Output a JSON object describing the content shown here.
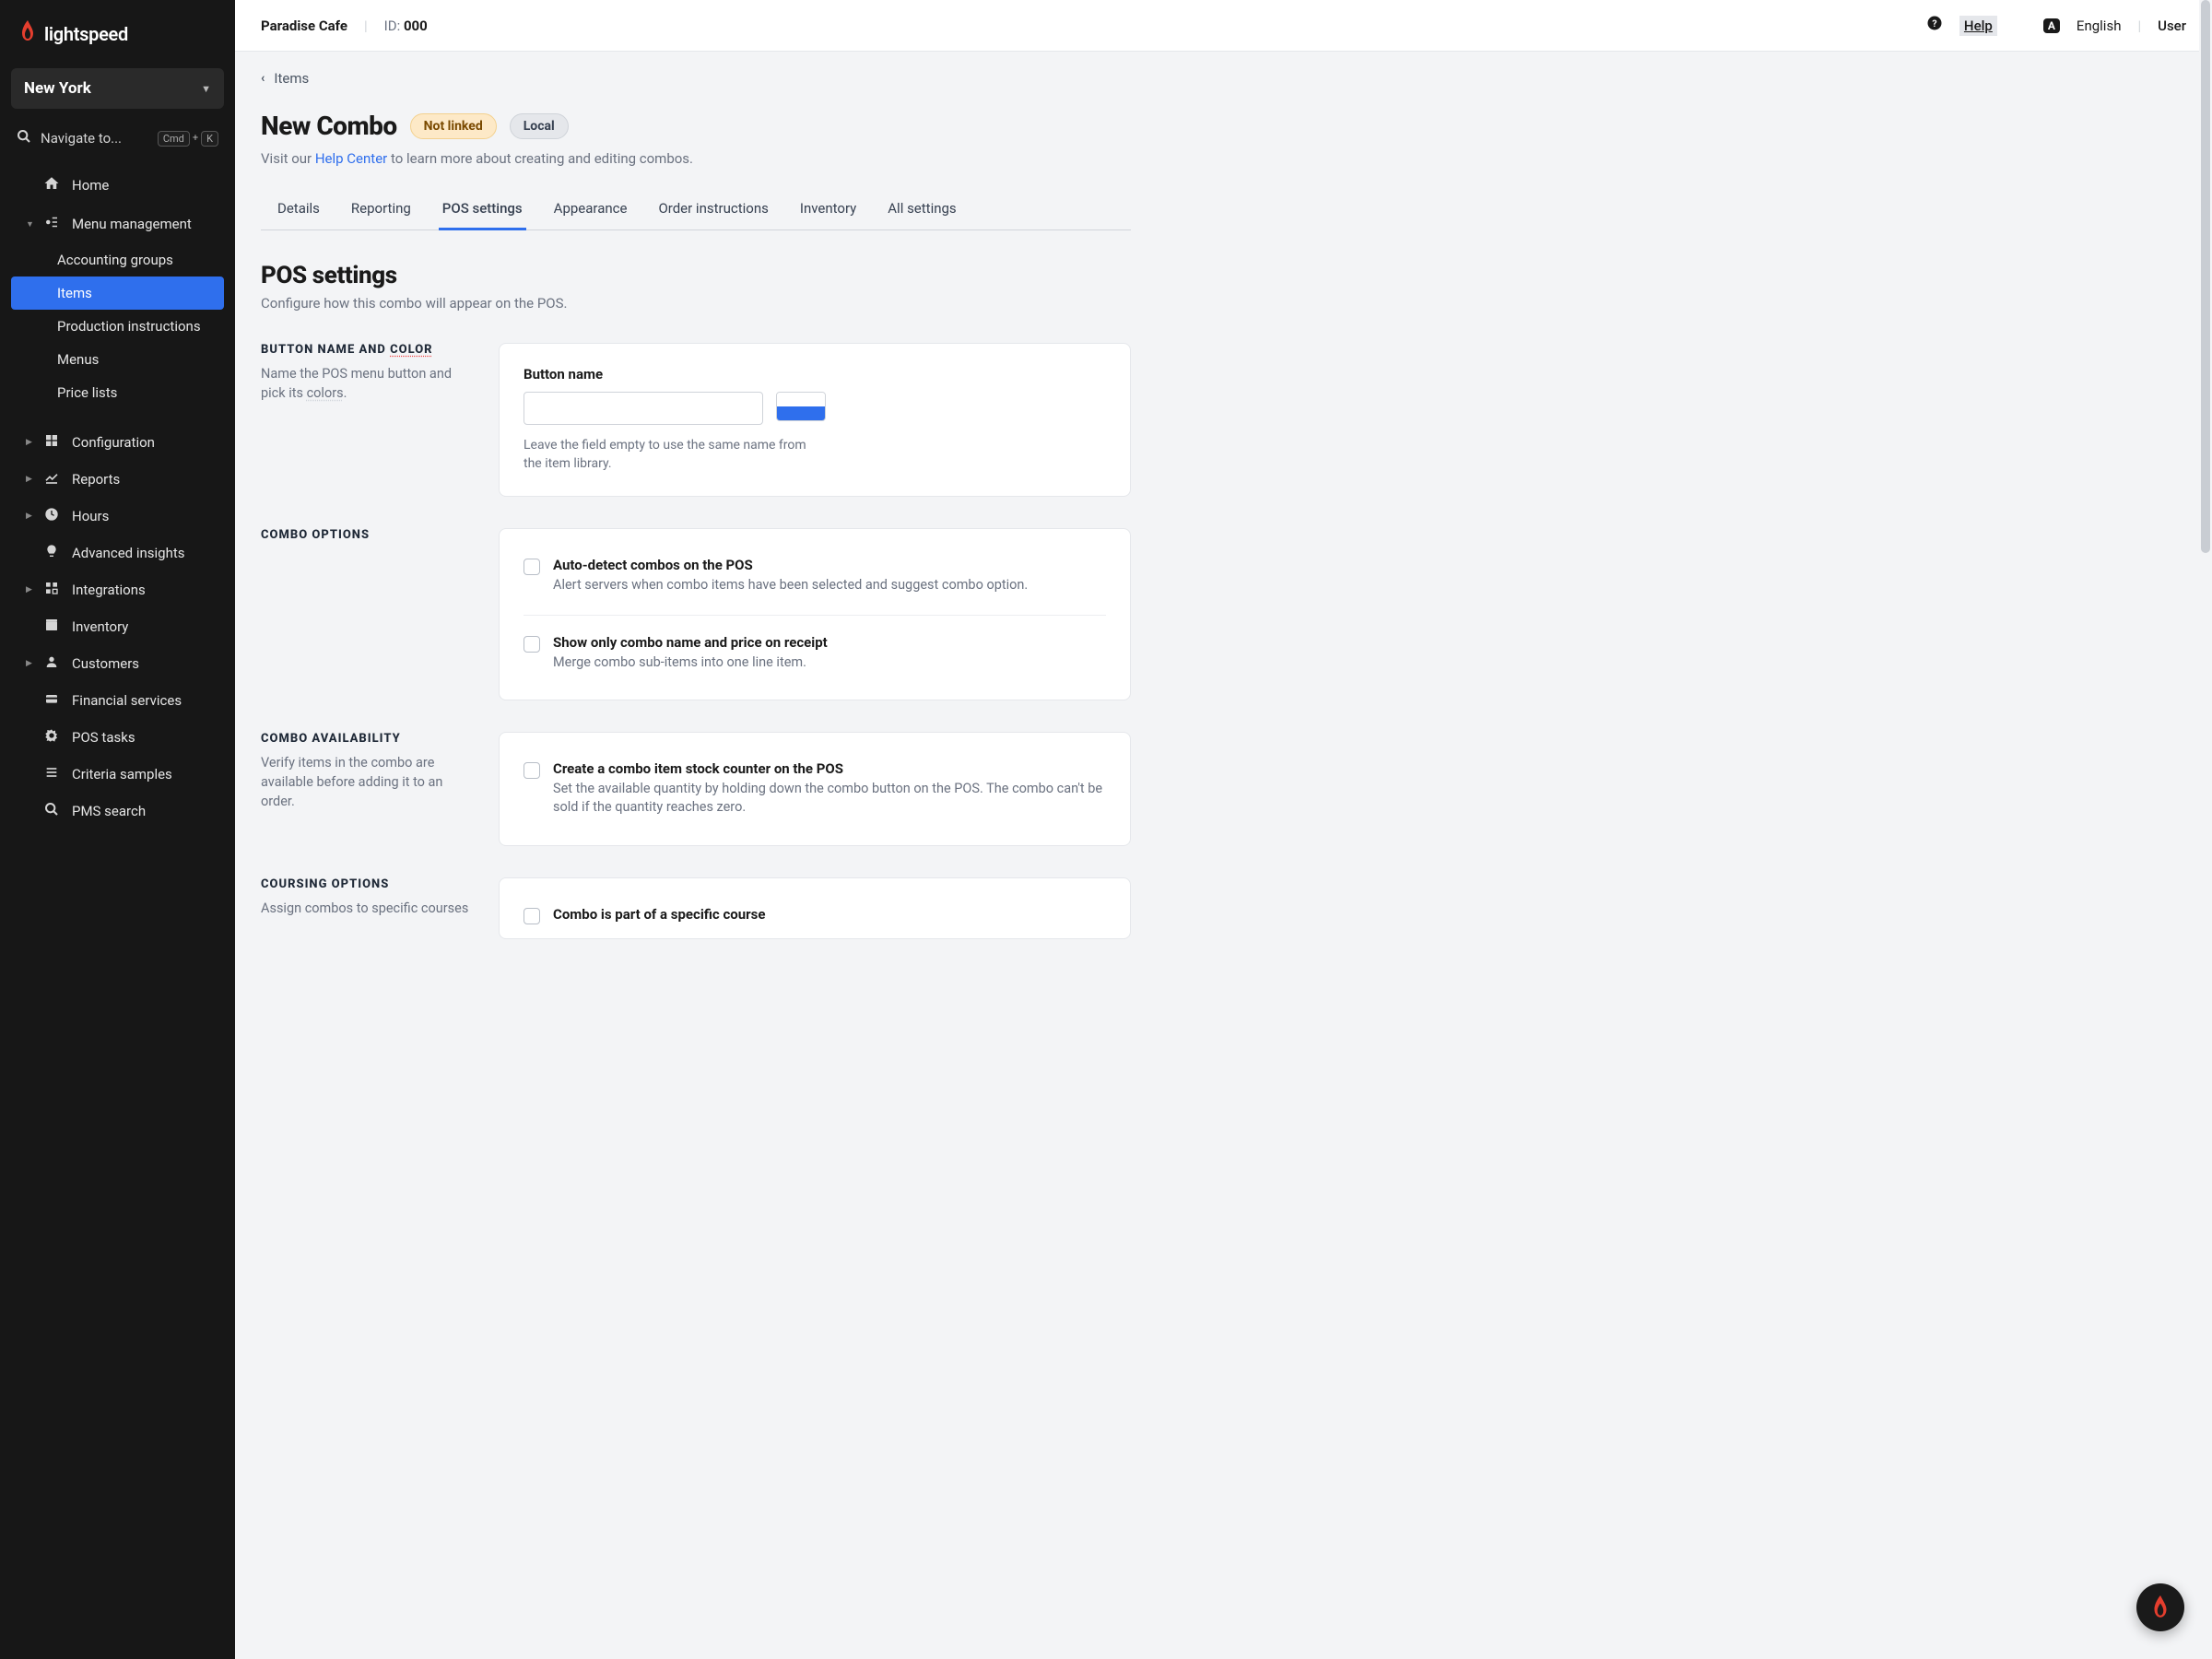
{
  "brand": "lightspeed",
  "location": "New York",
  "search_placeholder": "Navigate to...",
  "kbd1": "Cmd",
  "kbd_plus": "+",
  "kbd2": "K",
  "nav": {
    "home": "Home",
    "menu_mgmt": "Menu management",
    "menu_sub": {
      "accounting": "Accounting groups",
      "items": "Items",
      "production": "Production instructions",
      "menus": "Menus",
      "price": "Price lists"
    },
    "configuration": "Configuration",
    "reports": "Reports",
    "hours": "Hours",
    "insights": "Advanced insights",
    "integrations": "Integrations",
    "inventory": "Inventory",
    "customers": "Customers",
    "financial": "Financial services",
    "pos_tasks": "POS tasks",
    "criteria": "Criteria samples",
    "pms": "PMS search"
  },
  "topbar": {
    "business": "Paradise Cafe",
    "id_label": "ID:",
    "id_value": "000",
    "help": "Help",
    "language": "English",
    "lang_badge": "A",
    "user": "User"
  },
  "breadcrumb": "Items",
  "page": {
    "title": "New Combo",
    "pill_notlinked": "Not linked",
    "pill_local": "Local",
    "intro_a": "Visit our ",
    "intro_link": "Help Center",
    "intro_b": " to learn more about creating and editing combos."
  },
  "tabs": {
    "details": "Details",
    "reporting": "Reporting",
    "pos": "POS settings",
    "appearance": "Appearance",
    "order": "Order instructions",
    "inventory": "Inventory",
    "all": "All settings"
  },
  "section": {
    "title": "POS settings",
    "sub": "Configure how this combo will appear on the POS."
  },
  "button_name": {
    "heading_a": "BUTTON NAME AND ",
    "heading_b": "COLOR",
    "desc_a": "Name the POS menu button and pick its ",
    "desc_b": "colors",
    "desc_c": ".",
    "field_label": "Button name",
    "help": "Leave the field empty to use the same name from the item library."
  },
  "combo_options": {
    "heading": "COMBO OPTIONS",
    "opt1_t": "Auto-detect combos on the POS",
    "opt1_d": "Alert servers when combo items have been selected and suggest combo option.",
    "opt2_t": "Show only combo name and price on receipt",
    "opt2_d": "Merge combo sub-items into one line item."
  },
  "combo_avail": {
    "heading": "COMBO AVAILABILITY",
    "desc": "Verify items in the combo are available before adding it to an order.",
    "opt_t": "Create a combo item stock counter on the POS",
    "opt_d": "Set the available quantity by holding down the combo button on the POS. The combo can't be sold if the quantity reaches zero."
  },
  "coursing": {
    "heading": "COURSING OPTIONS",
    "desc": "Assign combos to specific courses",
    "opt_t": "Combo is part of a specific course"
  }
}
